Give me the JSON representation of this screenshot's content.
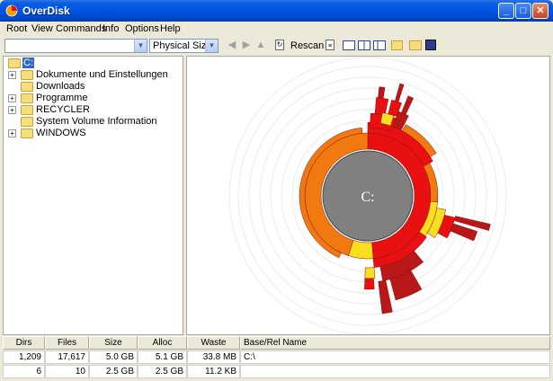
{
  "window": {
    "title": "OverDisk"
  },
  "menu": [
    "Root",
    "View",
    "Commands",
    "Info",
    "Options",
    "Help"
  ],
  "toolbar": {
    "path_value": "",
    "size_mode": "Physical Size",
    "rescan_label": "Rescan"
  },
  "tree": {
    "root_label": "C:",
    "items": [
      {
        "label": "Dokumente und Einstellungen",
        "expandable": true
      },
      {
        "label": "Downloads",
        "expandable": false
      },
      {
        "label": "Programme",
        "expandable": true
      },
      {
        "label": "RECYCLER",
        "expandable": true
      },
      {
        "label": "System Volume Information",
        "expandable": false
      },
      {
        "label": "WINDOWS",
        "expandable": true
      }
    ]
  },
  "chart": {
    "center_label": "C:"
  },
  "status": {
    "headers": [
      "Dirs",
      "Files",
      "Size",
      "Alloc",
      "Waste",
      "Base/Rel Name"
    ],
    "rows": [
      [
        "1,209",
        "17,617",
        "5.0 GB",
        "5.1 GB",
        "33.8 MB",
        "C:\\"
      ],
      [
        "6",
        "10",
        "2.5 GB",
        "2.5 GB",
        "11.2 KB",
        ""
      ]
    ]
  },
  "colors": {
    "titlebar": "#0054e3",
    "selection": "#316ac5",
    "center": "#808080",
    "ring_red": "#e81010",
    "ring_orange": "#f07a10",
    "ring_yellow": "#f8e020",
    "ring_dark": "#b81818"
  }
}
